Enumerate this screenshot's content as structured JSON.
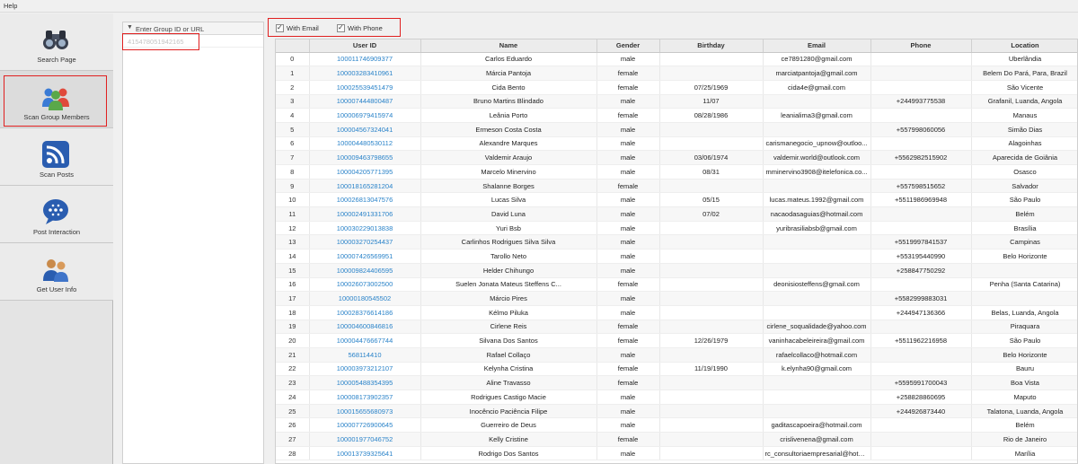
{
  "menu": {
    "help": "Help"
  },
  "nav": {
    "items": [
      {
        "label": "Search Page",
        "icon": "binoculars-icon"
      },
      {
        "label": "Scan Group Members",
        "icon": "group-members-icon"
      },
      {
        "label": "Scan Posts",
        "icon": "rss-icon"
      },
      {
        "label": "Post Interaction",
        "icon": "chat-bubble-icon"
      },
      {
        "label": "Get User Info",
        "icon": "users-icon"
      }
    ]
  },
  "group": {
    "header": "Enter Group ID or URL",
    "id_value": "415478051942165"
  },
  "options": {
    "with_email": {
      "label": "With Email",
      "checked": true
    },
    "with_phone": {
      "label": "With Phone",
      "checked": true
    }
  },
  "table": {
    "columns": [
      "",
      "User ID",
      "Name",
      "Gender",
      "Birthday",
      "Email",
      "Phone",
      "Location"
    ],
    "rows": [
      [
        "0",
        "100011746909377",
        "Carlos Eduardo",
        "male",
        "",
        "ce7891280@gmail.com",
        "",
        "Uberlândia"
      ],
      [
        "1",
        "100003283410961",
        "Márcia Pantoja",
        "female",
        "",
        "marciatpantoja@gmail.com",
        "",
        "Belem Do Pará, Para, Brazil"
      ],
      [
        "2",
        "100025539451479",
        "Cida Bento",
        "female",
        "07/25/1969",
        "cida4e@gmail.com",
        "",
        "São Vicente"
      ],
      [
        "3",
        "100007444800487",
        "Bruno Martins Blindado",
        "male",
        "11/07",
        "",
        "+244993775538",
        "Grafanil, Luanda, Angola"
      ],
      [
        "4",
        "100006979415974",
        "Leânia Porto",
        "female",
        "08/28/1986",
        "leanialima3@gmail.com",
        "",
        "Manaus"
      ],
      [
        "5",
        "100004567324041",
        "Ermeson Costa Costa",
        "male",
        "",
        "",
        "+557998060056",
        "Simão Dias"
      ],
      [
        "6",
        "100004480530112",
        "Alexandre Marques",
        "male",
        "",
        "carismanegocio_upnow@outloo...",
        "",
        "Alagoinhas"
      ],
      [
        "7",
        "100009463798655",
        "Valdemir Araujo",
        "male",
        "03/06/1974",
        "valdemir.world@outlook.com",
        "+5562982515902",
        "Aparecida de Goiânia"
      ],
      [
        "8",
        "100004205771395",
        "Marcelo Minervino",
        "male",
        "08/31",
        "mminervino3908@itelefonica.co...",
        "",
        "Osasco"
      ],
      [
        "9",
        "100018165281204",
        "Shalanne Borges",
        "female",
        "",
        "",
        "+557598515652",
        "Salvador"
      ],
      [
        "10",
        "100026813047576",
        "Lucas Silva",
        "male",
        "05/15",
        "lucas.mateus.1992@gmail.com",
        "+5511986969948",
        "São Paulo"
      ],
      [
        "11",
        "100002491331706",
        "David Luna",
        "male",
        "07/02",
        "nacaodasaguias@hotmail.com",
        "",
        "Belém"
      ],
      [
        "12",
        "100030229013838",
        "Yuri Bsb",
        "male",
        "",
        "yuribrasiliabsb@gmail.com",
        "",
        "Brasília"
      ],
      [
        "13",
        "100003270254437",
        "Carlinhos Rodrigues Silva Silva",
        "male",
        "",
        "",
        "+5519997841537",
        "Campinas"
      ],
      [
        "14",
        "100007426569951",
        "Tarollo Neto",
        "male",
        "",
        "",
        "+553195440990",
        "Belo Horizonte"
      ],
      [
        "15",
        "100009824406595",
        "Helder Chihungo",
        "male",
        "",
        "",
        "+258847750292",
        ""
      ],
      [
        "16",
        "100026073002500",
        "Suelen Jonata Mateus Steffens C...",
        "female",
        "",
        "deonisiosteffens@gmail.com",
        "",
        "Penha (Santa Catarina)"
      ],
      [
        "17",
        "100001805455​02",
        "Márcio Pires",
        "male",
        "",
        "",
        "+5582999883031",
        ""
      ],
      [
        "18",
        "100028376614186",
        "Kélmo Piluka",
        "male",
        "",
        "",
        "+244947136366",
        "Belas, Luanda, Angola"
      ],
      [
        "19",
        "100004600846816",
        "Cirlene Reis",
        "female",
        "",
        "cirlene_soqualidade@yahoo.com",
        "",
        "Piraquara"
      ],
      [
        "20",
        "100004476667744",
        "Silvana Dos Santos",
        "female",
        "12/26/1979",
        "vaninhacabeleireira@gmail.com",
        "+5511962216958",
        "São Paulo"
      ],
      [
        "21",
        "568114410",
        "Rafael Collaço",
        "male",
        "",
        "rafaelcollaco@hotmail.com",
        "",
        "Belo Horizonte"
      ],
      [
        "22",
        "100003973212107",
        "Kelynha Cristina",
        "female",
        "11/19/1990",
        "k.elynha90@gmail.com",
        "",
        "Bauru"
      ],
      [
        "23",
        "100005488354395",
        "Aline Travasso",
        "female",
        "",
        "",
        "+5595991700043",
        "Boa Vista"
      ],
      [
        "24",
        "100008173902357",
        "Rodrigues Castigo Macie",
        "male",
        "",
        "",
        "+258828860695",
        "Maputo"
      ],
      [
        "25",
        "100015655680973",
        "Inocêncio Paciência Filipe",
        "male",
        "",
        "",
        "+244926873440",
        "Talatona, Luanda, Angola"
      ],
      [
        "26",
        "100007726900645",
        "Guerreiro de Deus",
        "male",
        "",
        "gaditascapoeira@hotmail.com",
        "",
        "Belém"
      ],
      [
        "27",
        "100001977046752",
        "Kelly Cristine",
        "female",
        "",
        "crislivenena@gmail.com",
        "",
        "Rio de Janeiro"
      ],
      [
        "28",
        "100013739325641",
        "Rodrigo Dos Santos",
        "male",
        "",
        "rc_consultoriaempresarial@hotm...",
        "",
        "Marília"
      ]
    ]
  },
  "colors": {
    "link": "#2a83c9",
    "highlight": "#e02020"
  }
}
